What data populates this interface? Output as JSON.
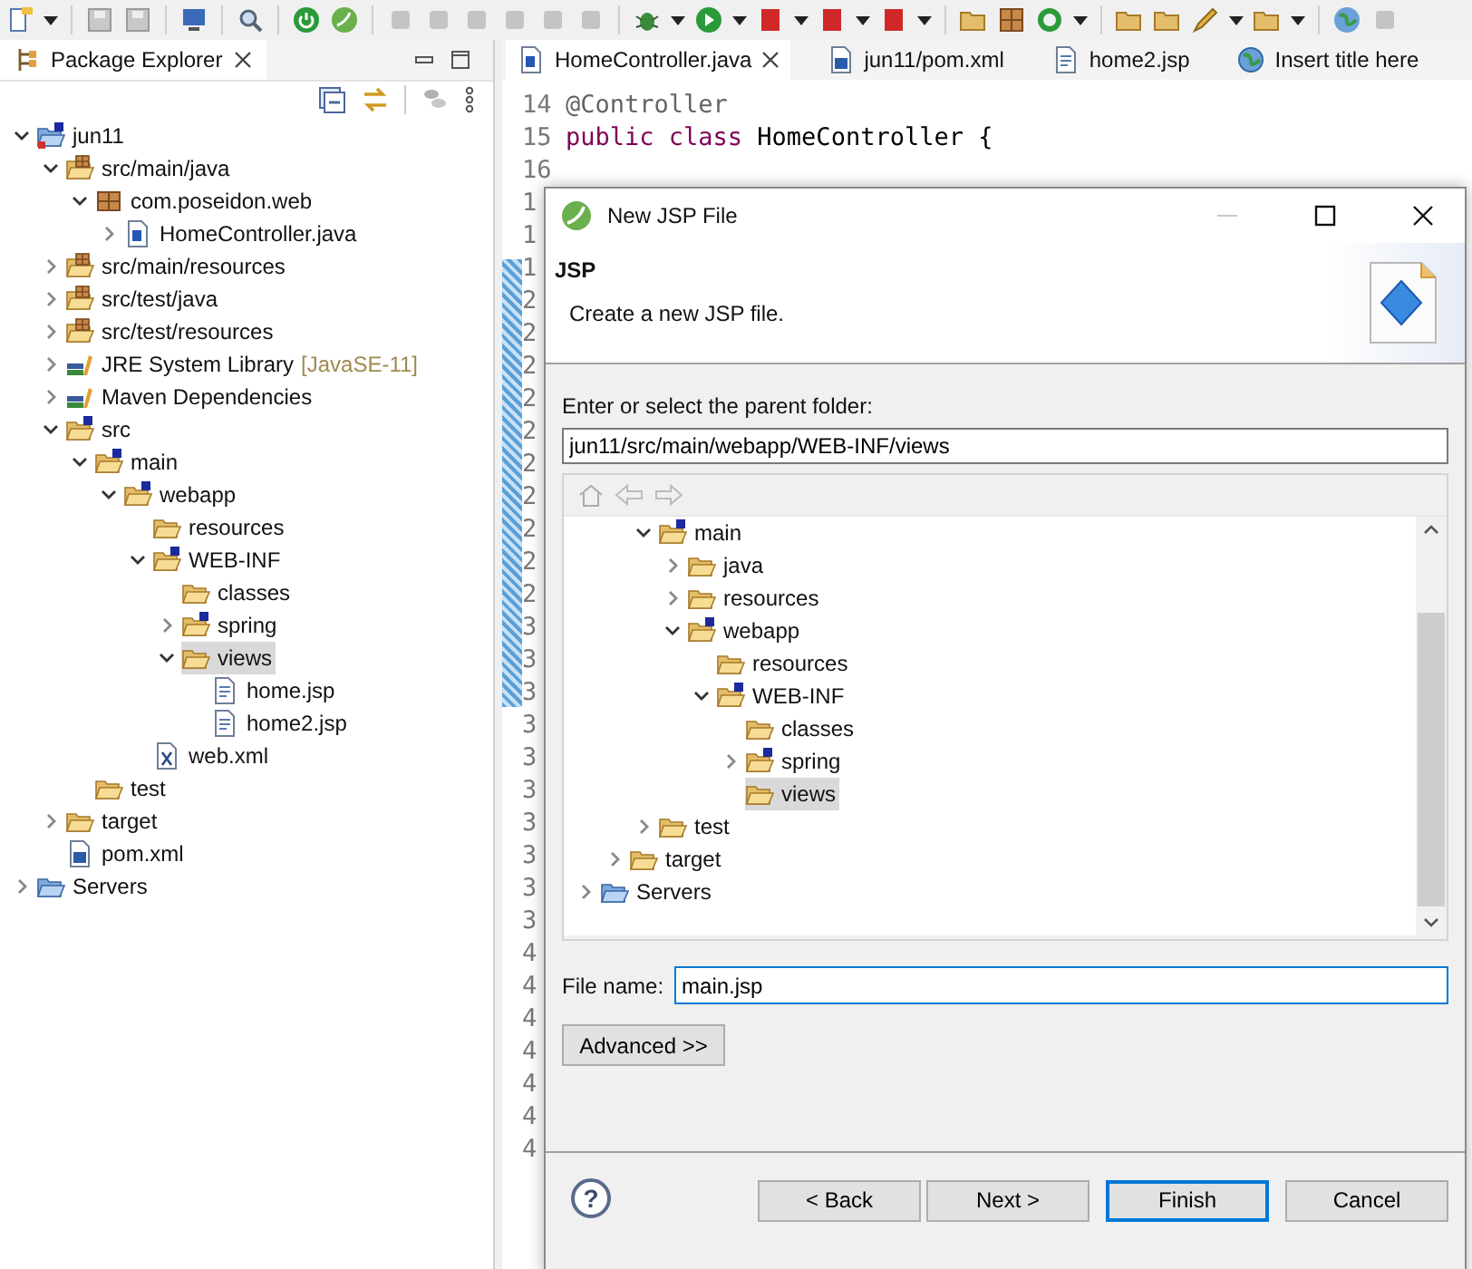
{
  "explorer": {
    "tabs": [
      {
        "label": "Package Explorer",
        "selected": true
      }
    ],
    "tree": [
      {
        "label": "jun11",
        "kind": "project",
        "expanded": true,
        "selected": false,
        "children": [
          {
            "label": "src/main/java",
            "kind": "source-folder",
            "expanded": true,
            "selected": false,
            "children": [
              {
                "label": "com.poseidon.web",
                "kind": "package",
                "expanded": true,
                "selected": false,
                "children": [
                  {
                    "label": "HomeController.java",
                    "kind": "java-file",
                    "expanded": false,
                    "selected": false
                  }
                ]
              }
            ]
          },
          {
            "label": "src/main/resources",
            "kind": "source-folder",
            "expanded": false,
            "selected": false
          },
          {
            "label": "src/test/java",
            "kind": "source-folder",
            "expanded": false,
            "selected": false
          },
          {
            "label": "src/test/resources",
            "kind": "source-folder",
            "expanded": false,
            "selected": false
          },
          {
            "label": "JRE System Library",
            "decoration": "[JavaSE-11]",
            "kind": "library",
            "expanded": false,
            "selected": false
          },
          {
            "label": "Maven Dependencies",
            "kind": "library",
            "expanded": false,
            "selected": false
          },
          {
            "label": "src",
            "kind": "spring-folder",
            "expanded": true,
            "selected": false,
            "children": [
              {
                "label": "main",
                "kind": "spring-folder",
                "expanded": true,
                "selected": false,
                "children": [
                  {
                    "label": "webapp",
                    "kind": "spring-folder",
                    "expanded": true,
                    "selected": false,
                    "children": [
                      {
                        "label": "resources",
                        "kind": "folder",
                        "selected": false
                      },
                      {
                        "label": "WEB-INF",
                        "kind": "spring-folder",
                        "expanded": true,
                        "selected": false,
                        "children": [
                          {
                            "label": "classes",
                            "kind": "folder",
                            "selected": false
                          },
                          {
                            "label": "spring",
                            "kind": "spring-folder",
                            "expanded": false,
                            "selected": false
                          },
                          {
                            "label": "views",
                            "kind": "folder",
                            "expanded": true,
                            "selected": true,
                            "children": [
                              {
                                "label": "home.jsp",
                                "kind": "jsp-file",
                                "selected": false
                              },
                              {
                                "label": "home2.jsp",
                                "kind": "jsp-file",
                                "selected": false
                              }
                            ]
                          }
                        ]
                      },
                      {
                        "label": "web.xml",
                        "kind": "xml-file",
                        "selected": false
                      }
                    ]
                  }
                ]
              },
              {
                "label": "test",
                "kind": "folder",
                "selected": false
              }
            ]
          },
          {
            "label": "target",
            "kind": "folder",
            "expanded": false,
            "selected": false
          },
          {
            "label": "pom.xml",
            "kind": "pom-file",
            "selected": false
          }
        ]
      },
      {
        "label": "Servers",
        "kind": "servers-folder",
        "expanded": false,
        "selected": false
      }
    ]
  },
  "editor": {
    "tabs": [
      {
        "label": "HomeController.java",
        "kind": "java-file",
        "selected": true
      },
      {
        "label": "jun11/pom.xml",
        "kind": "pom-file",
        "selected": false
      },
      {
        "label": "home2.jsp",
        "kind": "jsp-file",
        "selected": false
      },
      {
        "label": "Insert title here",
        "kind": "web-page",
        "selected": false
      }
    ],
    "lines": [
      {
        "number": "14",
        "tokens": [
          {
            "kind": "annotation",
            "text": "@Controller"
          }
        ]
      },
      {
        "number": "15",
        "tokens": [
          {
            "kind": "keyword",
            "text": "public class"
          },
          {
            "kind": "plain",
            "text": " HomeController {"
          }
        ]
      },
      {
        "number": "16"
      },
      {
        "number": "1"
      },
      {
        "number": "1"
      },
      {
        "number": "1"
      },
      {
        "number": "2"
      },
      {
        "number": "2"
      },
      {
        "number": "2"
      },
      {
        "number": "2"
      },
      {
        "number": "2"
      },
      {
        "number": "2"
      },
      {
        "number": "2"
      },
      {
        "number": "2"
      },
      {
        "number": "2"
      },
      {
        "number": "2"
      },
      {
        "number": "3"
      },
      {
        "number": "3"
      },
      {
        "number": "3"
      },
      {
        "number": "3"
      },
      {
        "number": "3"
      },
      {
        "number": "3"
      },
      {
        "number": "3"
      },
      {
        "number": "3"
      },
      {
        "number": "3"
      },
      {
        "number": "3"
      },
      {
        "number": "4"
      },
      {
        "number": "4"
      },
      {
        "number": "4"
      },
      {
        "number": "4"
      },
      {
        "number": "4"
      },
      {
        "number": "4"
      },
      {
        "number": "4"
      }
    ]
  },
  "dialog": {
    "title": "New JSP File",
    "title_buttons": [
      {
        "kind": "minimize",
        "disabled": true
      },
      {
        "kind": "maximize",
        "disabled": false
      },
      {
        "kind": "close",
        "disabled": false
      }
    ],
    "heading": "JSP",
    "description": "Create a new JSP file.",
    "folder_label": "Enter or select the parent folder:",
    "folder_value": "jun11/src/main/webapp/WEB-INF/views",
    "tree": [
      {
        "children": [
          {
            "children": [
              {
                "label": "main",
                "kind": "spring-folder",
                "expanded": true,
                "selected": false,
                "children": [
                  {
                    "label": "java",
                    "kind": "folder",
                    "expanded": false,
                    "selected": false
                  },
                  {
                    "label": "resources",
                    "kind": "folder",
                    "expanded": false,
                    "selected": false
                  },
                  {
                    "label": "webapp",
                    "kind": "spring-folder",
                    "expanded": true,
                    "selected": false,
                    "children": [
                      {
                        "label": "resources",
                        "kind": "folder",
                        "selected": false
                      },
                      {
                        "label": "WEB-INF",
                        "kind": "spring-folder",
                        "expanded": true,
                        "selected": false,
                        "children": [
                          {
                            "label": "classes",
                            "kind": "folder",
                            "selected": false
                          },
                          {
                            "label": "spring",
                            "kind": "spring-folder",
                            "expanded": false,
                            "selected": false
                          },
                          {
                            "label": "views",
                            "kind": "folder",
                            "selected": true
                          }
                        ]
                      }
                    ]
                  }
                ]
              },
              {
                "label": "test",
                "kind": "folder",
                "expanded": false,
                "selected": false
              }
            ]
          },
          {
            "label": "target",
            "kind": "folder",
            "expanded": false,
            "selected": false
          }
        ]
      },
      {
        "label": "Servers",
        "kind": "servers-folder",
        "expanded": false,
        "selected": false
      }
    ],
    "file_label": "File name:",
    "file_value": "main.jsp",
    "advanced_button": "Advanced >>",
    "help_button": "?",
    "buttons": [
      {
        "label": "< Back",
        "default": false
      },
      {
        "label": "Next >",
        "default": false
      },
      {
        "label": "Finish",
        "default": true
      },
      {
        "label": "Cancel",
        "default": false
      }
    ]
  }
}
